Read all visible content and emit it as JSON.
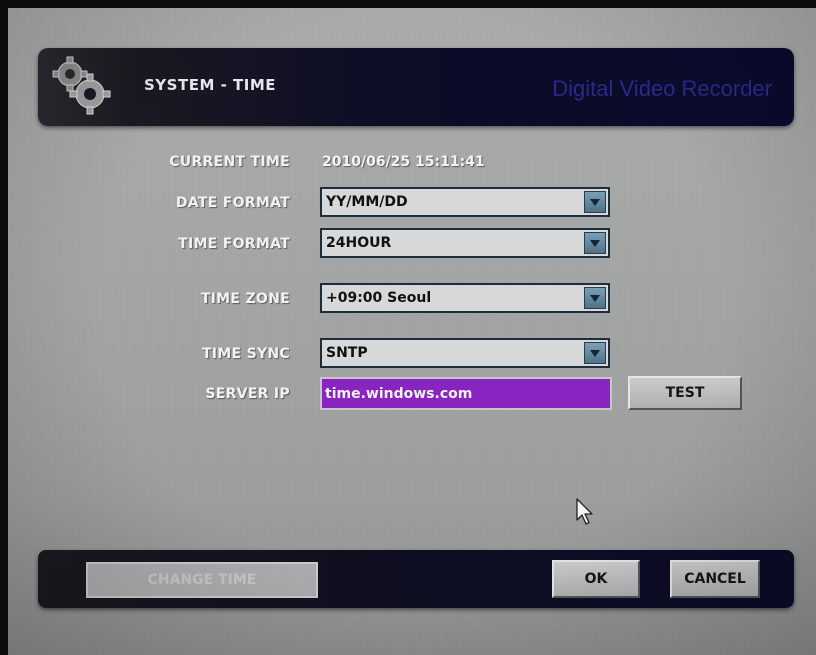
{
  "header": {
    "title": "SYSTEM - TIME",
    "brand": "Digital Video Recorder",
    "icon": "gears-icon"
  },
  "form": {
    "current_time": {
      "label": "CURRENT TIME",
      "value": "2010/06/25 15:11:41"
    },
    "date_format": {
      "label": "DATE FORMAT",
      "value": "YY/MM/DD"
    },
    "time_format": {
      "label": "TIME FORMAT",
      "value": "24HOUR"
    },
    "time_zone": {
      "label": "TIME ZONE",
      "value": "+09:00 Seoul"
    },
    "time_sync": {
      "label": "TIME SYNC",
      "value": "SNTP"
    },
    "server_ip": {
      "label": "SERVER IP",
      "value": "time.windows.com"
    },
    "test_label": "TEST"
  },
  "footer": {
    "change_time_label": "CHANGE TIME",
    "ok_label": "OK",
    "cancel_label": "CANCEL"
  },
  "colors": {
    "header_bg": "#0a0a2e",
    "brand_text": "#2a2a8a",
    "selected_field": "#8a24c0",
    "dropdown_arrow": "#4f7288",
    "screen_bg": "#a3a5a4"
  }
}
